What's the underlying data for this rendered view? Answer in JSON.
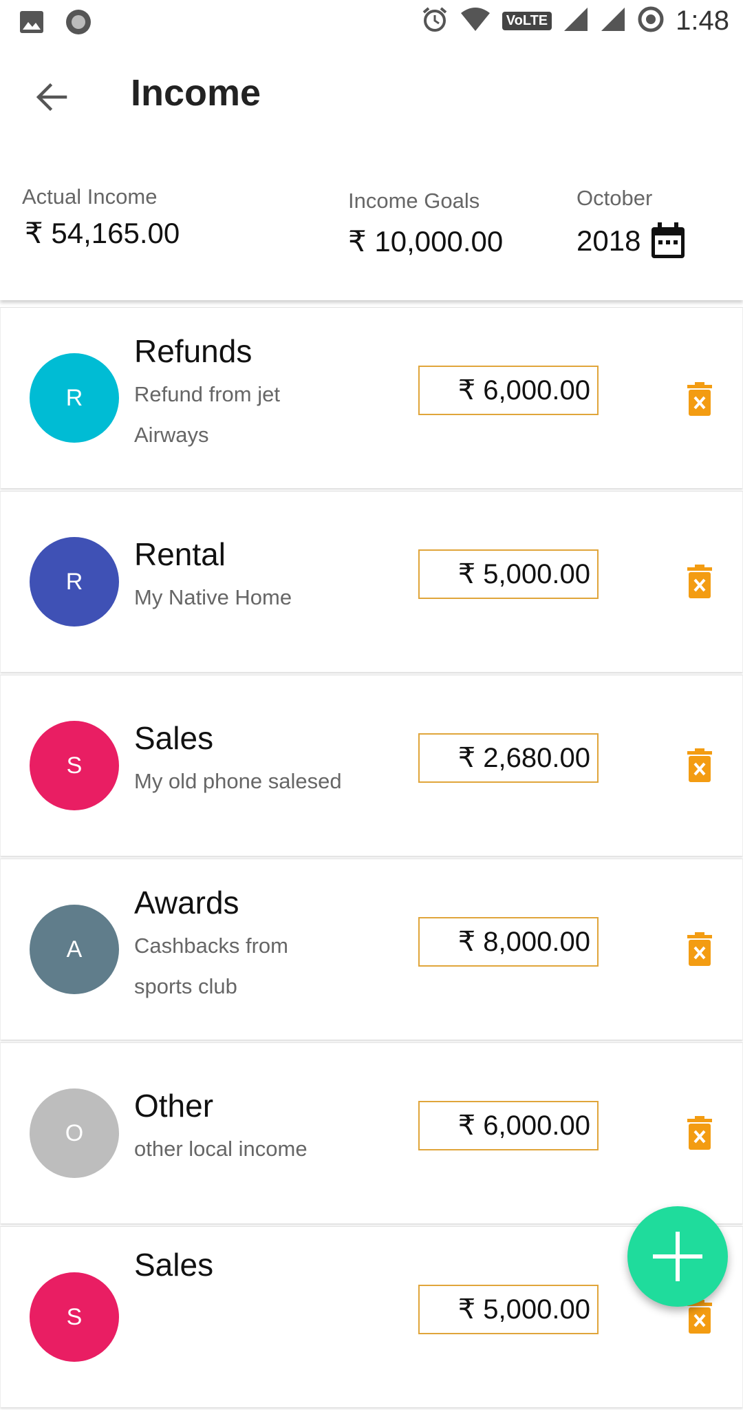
{
  "status_bar": {
    "time": "1:48",
    "volte": "VoLTE",
    "icons": [
      "image-icon",
      "record-icon",
      "alarm-icon",
      "wifi-icon",
      "volte-icon",
      "signal-icon",
      "signal-icon",
      "sync-icon"
    ]
  },
  "app_bar": {
    "title": "Income",
    "back_icon": "arrow-left-icon"
  },
  "summary": {
    "actual_label": "Actual Income",
    "actual_value": "₹ 54,165.00",
    "goals_label": "Income Goals",
    "goals_value": "₹ 10,000.00",
    "month": "October",
    "year": "2018",
    "calendar_icon": "calendar-icon"
  },
  "items": [
    {
      "initial": "R",
      "color": "#00bcd4",
      "title": "Refunds",
      "subtitle": "Refund from jet Airways",
      "amount": "₹ 6,000.00"
    },
    {
      "initial": "R",
      "color": "#3f51b5",
      "title": "Rental",
      "subtitle": "My Native Home",
      "amount": "₹ 5,000.00"
    },
    {
      "initial": "S",
      "color": "#e91e63",
      "title": "Sales",
      "subtitle": "My old phone salesed",
      "amount": "₹ 2,680.00"
    },
    {
      "initial": "A",
      "color": "#607d8b",
      "title": "Awards",
      "subtitle": "Cashbacks from sports club",
      "amount": "₹ 8,000.00"
    },
    {
      "initial": "O",
      "color": "#bdbdbd",
      "title": "Other",
      "subtitle": "other local income",
      "amount": "₹ 6,000.00"
    },
    {
      "initial": "S",
      "color": "#e91e63",
      "title": "Sales",
      "subtitle": "",
      "amount": "₹ 5,000.00"
    }
  ],
  "colors": {
    "accent_orange": "#f39c12",
    "fab_green": "#1fdc9c",
    "amount_border": "#e0a53a"
  },
  "fab": {
    "icon": "plus-icon"
  }
}
